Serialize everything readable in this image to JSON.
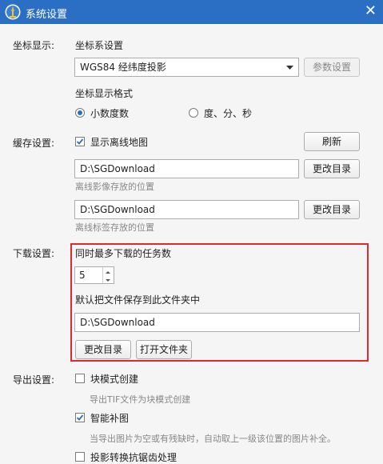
{
  "window": {
    "title": "系统设置",
    "close_glyph": "✕",
    "app_icon": "tower-icon",
    "accent_color": "#2b6fc4"
  },
  "coordinates": {
    "section_label": "坐标显示:",
    "system_label": "坐标系设置",
    "system_value": "WGS84 经纬度投影",
    "param_button": "参数设置",
    "format_label": "坐标显示格式",
    "format_options": [
      {
        "label": "小数度数",
        "selected": true
      },
      {
        "label": "度、分、秒",
        "selected": false
      }
    ]
  },
  "cache": {
    "section_label": "缓存设置:",
    "offline_map_label": "显示离线地图",
    "offline_map_checked": true,
    "refresh_button": "刷新",
    "image_path": "D:\\SGDownload",
    "image_change_button": "更改目录",
    "image_hint": "离线影像存放的位置",
    "label_path": "D:\\SGDownload",
    "label_change_button": "更改目录",
    "label_hint": "离线标签存放的位置"
  },
  "download": {
    "section_label": "下载设置:",
    "max_tasks_label": "同时最多下载的任务数",
    "max_tasks_value": "5",
    "default_folder_label": "默认把文件保存到此文件夹中",
    "folder_path": "D:\\SGDownload",
    "change_button": "更改目录",
    "open_button": "打开文件夹",
    "highlight_color": "#e02a2a"
  },
  "export": {
    "section_label": "导出设置:",
    "block_mode_label": "块模式创建",
    "block_mode_checked": false,
    "block_mode_hint": "导出TIF文件为块模式创建",
    "smart_fill_label": "智能补图",
    "smart_fill_checked": true,
    "smart_fill_hint": "当导出图片为空或有残缺时，自动取上一级该位置的图片补全。",
    "antialias_label": "投影转换抗锯齿处理",
    "antialias_checked": false
  }
}
